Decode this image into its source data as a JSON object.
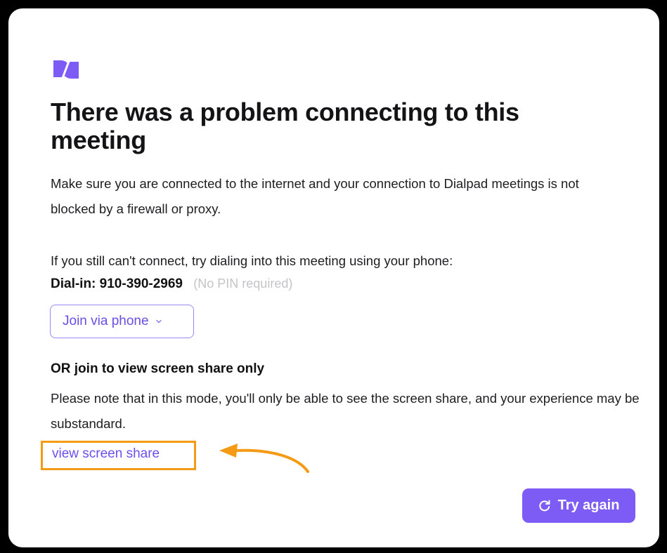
{
  "dialog": {
    "title": "There was a problem connecting to this meeting",
    "message": "Make sure you are connected to the internet and your connection to Dialpad meetings is not blocked by a firewall or proxy.",
    "phone_prompt": "If you still can't connect, try dialing into this meeting using your phone:",
    "dialin_label": "Dial-in:",
    "dialin_number": "910-390-2969",
    "pin_note": "(No PIN required)",
    "join_phone_button": "Join via phone",
    "screen_share_heading": "OR join to view screen share only",
    "screen_share_note": "Please note that in this mode, you'll only be able to see the screen share, and your experience may be substandard.",
    "screen_share_link": "view screen share",
    "try_again_button": "Try again"
  },
  "colors": {
    "brand": "#7c5cf4",
    "annotation": "#f59a14",
    "link": "#6d4ef0"
  },
  "icons": {
    "logo": "dialpad-logo-icon",
    "dropdown": "chevron-down-icon",
    "retry": "refresh-icon",
    "annotation": "arrow-annotation-icon"
  }
}
